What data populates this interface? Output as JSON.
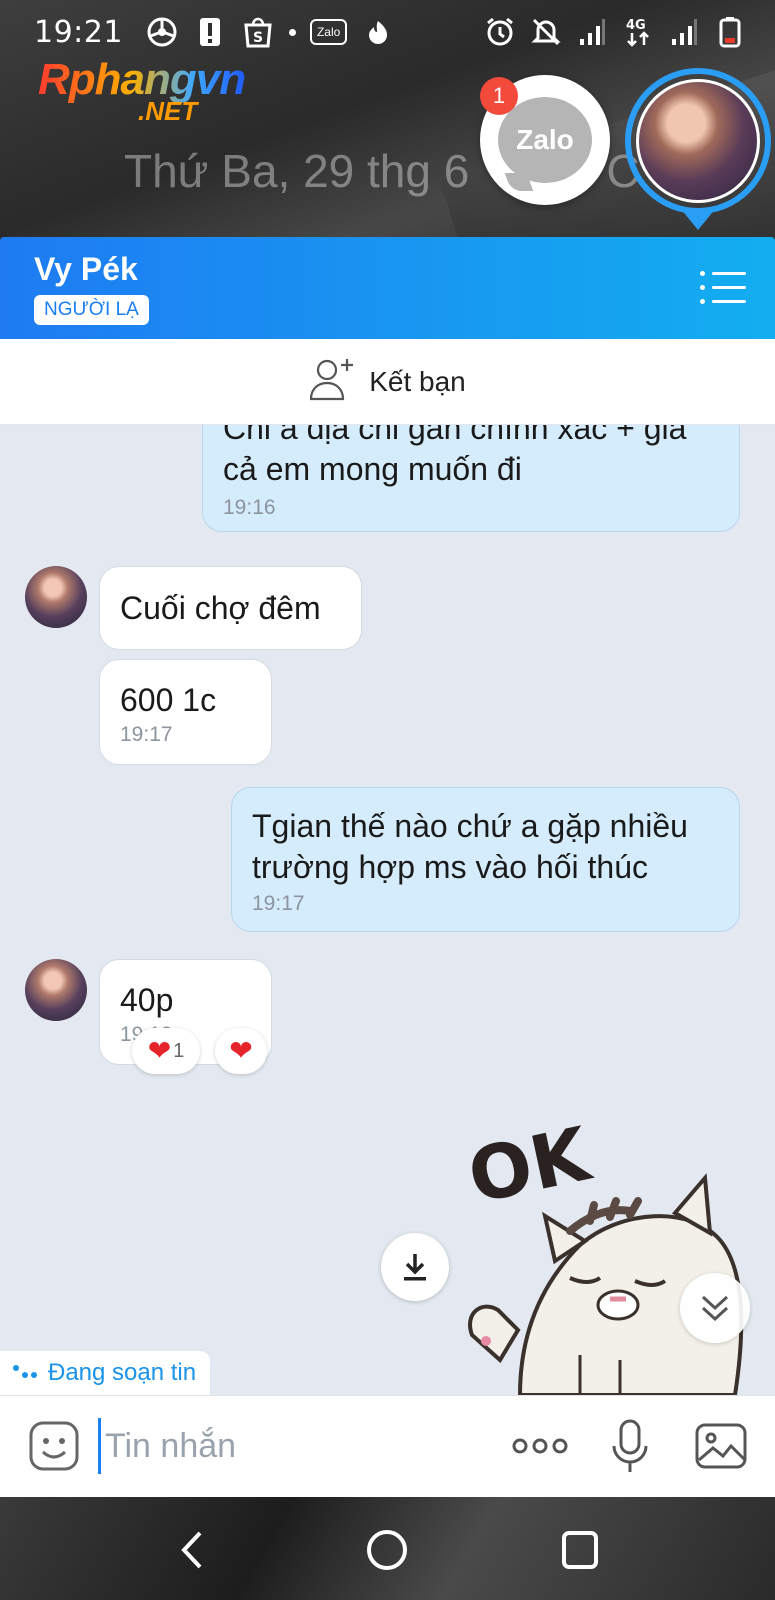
{
  "status_bar": {
    "time": "19:21",
    "network": "4G",
    "icons": [
      "steering-wheel-icon",
      "alert-icon",
      "shopee-icon",
      "zalo-icon",
      "flame-icon",
      "alarm-icon",
      "mute-icon",
      "signal-icon",
      "signal-4g-icon",
      "battery-icon"
    ]
  },
  "overlay": {
    "watermark_brand": "Rphangvn",
    "watermark_domain": ".NET",
    "lock_date": "Thứ Ba, 29 thg 6",
    "lock_date_tail": "°C",
    "zalo_head_label": "Zalo",
    "notification_count": "1"
  },
  "header": {
    "contact_name": "Vy Pék",
    "stranger_label": "NGƯỜI LẠ"
  },
  "add_friend": {
    "label": "Kết bạn"
  },
  "messages": [
    {
      "direction": "out",
      "text": "Chỉ a địa chỉ gần chính xác + giá cả em mong muốn đi",
      "time": "19:16"
    },
    {
      "direction": "in",
      "text": "Cuối chợ đêm",
      "time": ""
    },
    {
      "direction": "in",
      "text": "600 1c",
      "time": "19:17"
    },
    {
      "direction": "out",
      "text": "Tgian thế nào chứ a gặp nhiều trường hợp ms vào hối thúc",
      "time": "19:17"
    },
    {
      "direction": "in",
      "text": "40p",
      "time": "19:19"
    }
  ],
  "reactions": {
    "heart_count": "1"
  },
  "sticker": {
    "text": "OK"
  },
  "typing": {
    "label": "Đang soạn tin"
  },
  "input": {
    "placeholder": "Tin nhắn"
  },
  "colors": {
    "header_start": "#1e7bf2",
    "header_end": "#13aef0",
    "outgoing_bubble": "#d5ecfc",
    "incoming_bubble": "#ffffff",
    "chat_background": "#e4e8f0",
    "heart": "#e5252a"
  }
}
